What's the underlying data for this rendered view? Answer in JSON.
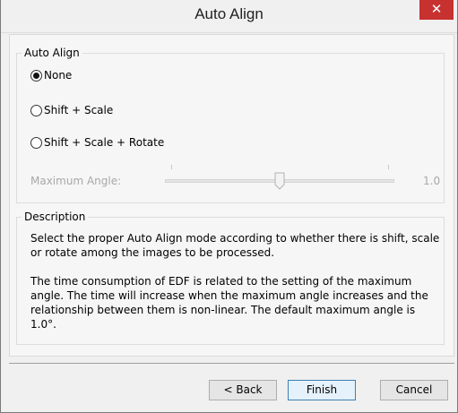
{
  "window": {
    "title": "Auto Align",
    "close_glyph": "✕"
  },
  "auto_align": {
    "legend": "Auto Align",
    "options": [
      {
        "label": "None",
        "checked": true
      },
      {
        "label": "Shift + Scale",
        "checked": false
      },
      {
        "label": "Shift + Scale + Rotate",
        "checked": false
      }
    ],
    "slider": {
      "label": "Maximum Angle:",
      "value_text": "1.0",
      "value_fraction": 0.5,
      "enabled": false
    }
  },
  "description": {
    "legend": "Description",
    "paragraphs": [
      "Select the proper Auto Align mode according to whether there is shift, scale or rotate among the images to be processed.",
      "The time consumption of EDF is related to the setting of the maximum angle. The time will increase when the maximum angle increases and the relationship between them is non-linear. The default maximum angle is 1.0°."
    ]
  },
  "buttons": {
    "back": "< Back",
    "finish": "Finish",
    "cancel": "Cancel"
  },
  "colors": {
    "close_button": "#c7312f",
    "disabled_text": "#a8a8a8",
    "primary_border": "#3c7fb1"
  }
}
